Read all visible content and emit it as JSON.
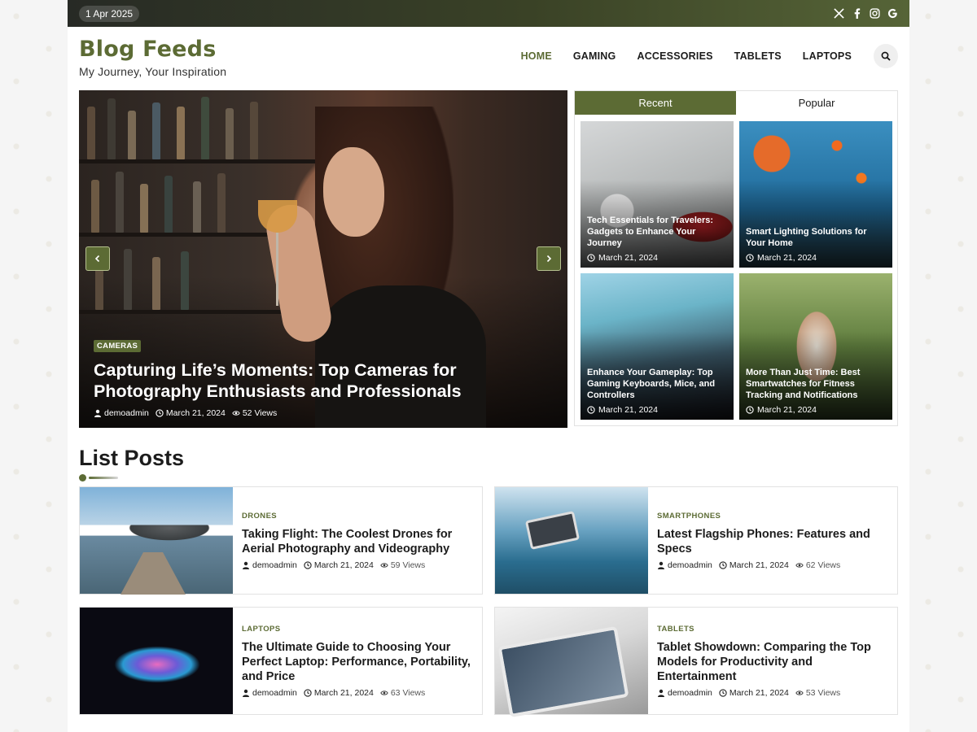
{
  "topbar": {
    "date": "1 Apr 2025",
    "social_icons": [
      "x-icon",
      "facebook-icon",
      "instagram-icon",
      "google-icon"
    ]
  },
  "header": {
    "site_title": "Blog Feeds",
    "tagline": "My Journey, Your Inspiration",
    "nav": [
      {
        "label": "HOME",
        "active": true
      },
      {
        "label": "GAMING",
        "active": false
      },
      {
        "label": "ACCESSORIES",
        "active": false
      },
      {
        "label": "TABLETS",
        "active": false
      },
      {
        "label": "LAPTOPS",
        "active": false
      }
    ]
  },
  "hero": {
    "category": "CAMERAS",
    "title": "Capturing Life’s Moments: Top Cameras for Photography Enthusiasts and Professionals",
    "author": "demoadmin",
    "date": "March 21, 2024",
    "views": "52 Views"
  },
  "side_tabs": {
    "tabs": [
      "Recent",
      "Popular"
    ],
    "active_tab": "Recent",
    "cards": [
      {
        "title": "Tech Essentials for Travelers: Gadgets to Enhance Your Journey",
        "date": "March 21, 2024"
      },
      {
        "title": "Smart Lighting Solutions for Your Home",
        "date": "March 21, 2024"
      },
      {
        "title": "Enhance Your Gameplay: Top Gaming Keyboards, Mice, and Controllers",
        "date": "March 21, 2024"
      },
      {
        "title": "More Than Just Time: Best Smartwatches for Fitness Tracking and Notifications",
        "date": "March 21, 2024"
      }
    ]
  },
  "list_posts": {
    "heading": "List Posts",
    "posts": [
      {
        "category": "DRONES",
        "title": "Taking Flight: The Coolest Drones for Aerial Photography and Videography",
        "author": "demoadmin",
        "date": "March 21, 2024",
        "views": "59 Views"
      },
      {
        "category": "SMARTPHONES",
        "title": "Latest Flagship Phones: Features and Specs",
        "author": "demoadmin",
        "date": "March 21, 2024",
        "views": "62 Views"
      },
      {
        "category": "LAPTOPS",
        "title": "The Ultimate Guide to Choosing Your Perfect Laptop: Performance, Portability, and Price",
        "author": "demoadmin",
        "date": "March 21, 2024",
        "views": "63 Views"
      },
      {
        "category": "TABLETS",
        "title": "Tablet Showdown: Comparing the Top Models for Productivity and Entertainment",
        "author": "demoadmin",
        "date": "March 21, 2024",
        "views": "53 Views"
      }
    ]
  },
  "colors": {
    "accent": "#5c6b34",
    "topbar_dark": "#272a25"
  }
}
